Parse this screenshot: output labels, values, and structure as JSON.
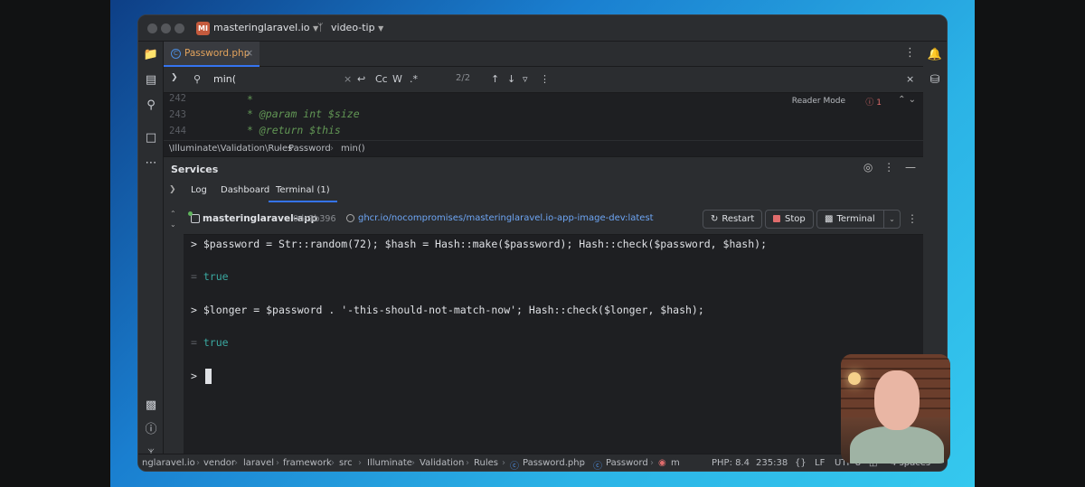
{
  "titlebar": {
    "project_badge": "MI",
    "project_name": "masteringlaravel.io",
    "branch_name": "video-tip"
  },
  "editor": {
    "tab_label": "Password.php",
    "find_query": "min(",
    "find_options": [
      "Cc",
      "W",
      ".*"
    ],
    "find_count": "2/2",
    "reader_mode": "Reader Mode",
    "error_count": "1",
    "lines": [
      {
        "num": "242",
        "text": "*"
      },
      {
        "num": "243",
        "text": "* @param  int  $size"
      },
      {
        "num": "244",
        "text": "* @return $this"
      }
    ],
    "breadcrumb": [
      "\\Illuminate\\Validation\\Rules",
      "Password",
      "min()"
    ]
  },
  "services": {
    "title": "Services",
    "tabs": [
      "Log",
      "Dashboard",
      "Terminal (1)"
    ],
    "container_name": "masteringlaravel-app",
    "container_hash": "0dc9b396",
    "image_link": "ghcr.io/nocompromises/masteringlaravel.io-app-image-dev:latest",
    "buttons": {
      "restart": "Restart",
      "stop": "Stop",
      "terminal": "Terminal"
    }
  },
  "terminal": {
    "lines": [
      {
        "prompt": ">",
        "text": "$password = Str::random(72); $hash = Hash::make($password); Hash::check($password, $hash);"
      },
      {
        "prompt": "=",
        "text": "true"
      },
      {
        "prompt": ">",
        "text": "$longer = $password . '-this-should-not-match-now'; Hash::check($longer, $hash);"
      },
      {
        "prompt": "=",
        "text": "true"
      },
      {
        "prompt": ">",
        "text": ""
      }
    ]
  },
  "statusbar": {
    "path": [
      "nglaravel.io",
      "vendor",
      "laravel",
      "framework",
      "src",
      "Illuminate",
      "Validation",
      "Rules",
      "Password.php",
      "Password",
      "m"
    ],
    "php": "PHP: 8.4",
    "position": "235:38",
    "braces": "{}",
    "line_ending": "LF",
    "encoding": "UTF-8",
    "indent": "4 spaces"
  },
  "colors": {
    "accent": "#3574f0",
    "tab_text": "#e3a35c",
    "result": "#3aa8a0",
    "link": "#6ea6f5"
  }
}
